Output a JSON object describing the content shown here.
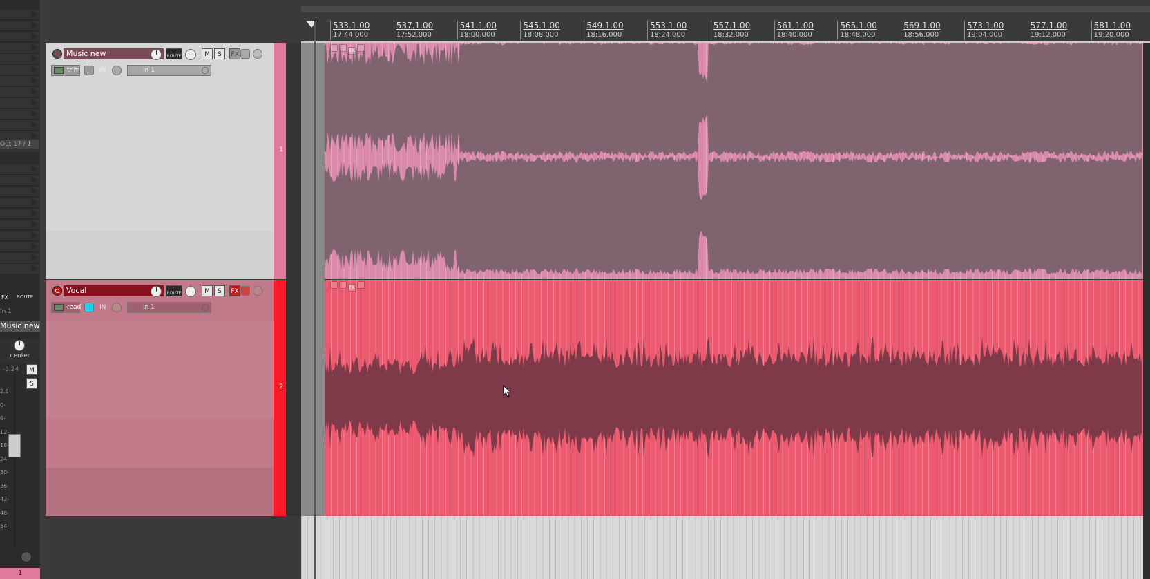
{
  "mixer": {
    "out_label": "Out 17 / 1",
    "fx_label": "FX",
    "route_label": "ROUTE",
    "in_label": "In 1",
    "track_name": "Music new",
    "pan_label": "center",
    "volume_readout": "-3.24",
    "mute_label": "M",
    "solo_label": "S",
    "db_scale": [
      "2.8",
      "0-",
      "6-",
      "12-",
      "18-",
      "24-",
      "30-",
      "36-",
      "42-",
      "48-",
      "54-"
    ],
    "track_number": "1"
  },
  "tracks": [
    {
      "name": "Music new",
      "number": "1",
      "route_label": "ROUTE",
      "mute_label": "M",
      "solo_label": "S",
      "fx_label": "FX",
      "env_mode": "trim",
      "in_label": "IN",
      "input": "In 1",
      "item_icons": [
        "FX"
      ],
      "color": "#d88aa8"
    },
    {
      "name": "Vocal",
      "number": "2",
      "route_label": "ROUTE",
      "mute_label": "M",
      "solo_label": "S",
      "fx_label": "FX",
      "env_mode": "read",
      "in_label": "IN",
      "input": "In 1",
      "item_icons": [
        "FX"
      ],
      "color": "#ec5a70"
    }
  ],
  "ruler": {
    "bars": [
      "533.1.00",
      "537.1.00",
      "541.1.00",
      "545.1.00",
      "549.1.00",
      "553.1.00",
      "557.1.00",
      "561.1.00",
      "565.1.00",
      "569.1.00",
      "573.1.00",
      "577.1.00",
      "581.1.00"
    ],
    "times": [
      "17:44.000",
      "17:52.000",
      "18:00.000",
      "18:08.000",
      "18:16.000",
      "18:24.000",
      "18:32.000",
      "18:40.000",
      "18:48.000",
      "18:56.000",
      "19:04.000",
      "19:12.000",
      "19:20.000"
    ]
  }
}
